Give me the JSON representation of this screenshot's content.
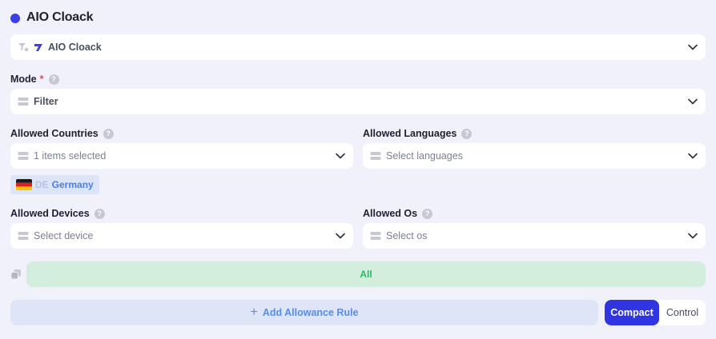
{
  "header": {
    "title": "AIO Cloack"
  },
  "integration_select": {
    "value": "AIO Cloack"
  },
  "mode": {
    "label": "Mode",
    "required_mark": "*",
    "help": "?",
    "value": "Filter"
  },
  "countries": {
    "label": "Allowed Countries",
    "help": "?",
    "value": "1 items selected",
    "chips": [
      {
        "code": "DE",
        "name": "Germany"
      }
    ]
  },
  "languages": {
    "label": "Allowed Languages",
    "help": "?",
    "placeholder": "Select languages"
  },
  "devices": {
    "label": "Allowed Devices",
    "help": "?",
    "placeholder": "Select device"
  },
  "os": {
    "label": "Allowed Os",
    "help": "?",
    "placeholder": "Select os"
  },
  "rule_bar": {
    "text": "All"
  },
  "actions": {
    "add_plus": "+",
    "add_label": "Add Allowance Rule"
  },
  "view_toggle": {
    "options": [
      "Compact",
      "Control"
    ],
    "selected": "Compact"
  },
  "colors": {
    "accent": "#2f35e0",
    "rule_bg": "#d3eedd",
    "rule_text": "#2fb864"
  }
}
